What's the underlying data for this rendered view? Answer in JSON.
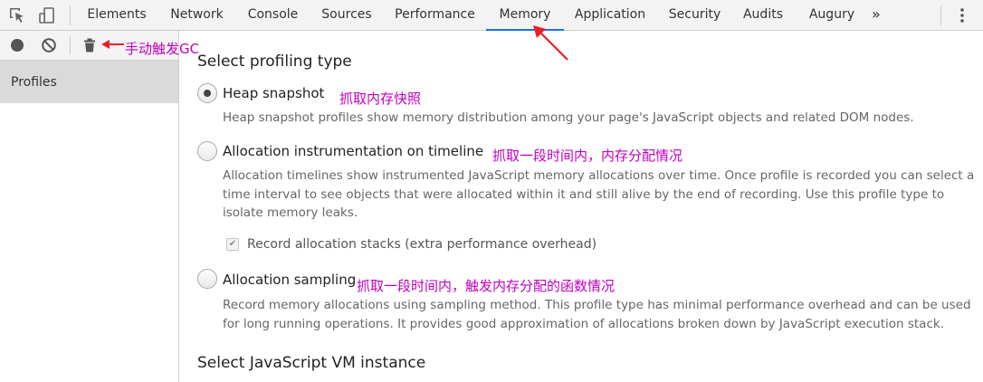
{
  "tabs": [
    "Elements",
    "Network",
    "Console",
    "Sources",
    "Performance",
    "Memory",
    "Application",
    "Security",
    "Audits",
    "Augury"
  ],
  "active_tab": "Memory",
  "more_tabs": "»",
  "sidebar": {
    "items": [
      {
        "label": "Profiles"
      }
    ]
  },
  "annotations": {
    "gc": "手动触发GC",
    "heap": "抓取内存快照",
    "timeline": "抓取一段时间内，内存分配情况",
    "sampling": "抓取一段时间内，触发内存分配的函数情况"
  },
  "main": {
    "profiling_title": "Select profiling type",
    "options": [
      {
        "label": "Heap snapshot",
        "checked": true,
        "description": "Heap snapshot profiles show memory distribution among your page's JavaScript objects and related DOM nodes."
      },
      {
        "label": "Allocation instrumentation on timeline",
        "checked": false,
        "description": "Allocation timelines show instrumented JavaScript memory allocations over time. Once profile is recorded you can select a time interval to see objects that were allocated within it and still alive by the end of recording. Use this profile type to isolate memory leaks."
      },
      {
        "label": "Allocation sampling",
        "checked": false,
        "description": "Record memory allocations using sampling method. This profile type has minimal performance overhead and can be used for long running operations. It provides good approximation of allocations broken down by JavaScript execution stack."
      }
    ],
    "record_stacks_label": "Record allocation stacks (extra performance overhead)",
    "record_stacks_checked": true,
    "vm_title": "Select JavaScript VM instance"
  },
  "colors": {
    "accent": "#1a73e8",
    "annotation": "#c000c0",
    "arrow": "#e8202a"
  }
}
